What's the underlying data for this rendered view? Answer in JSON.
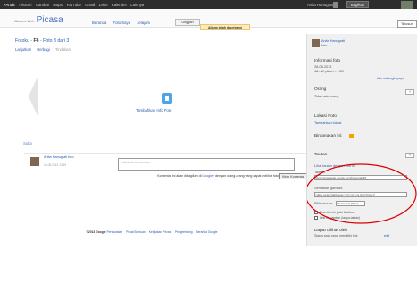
{
  "topbar": {
    "nav": [
      "+Anda",
      "Telusuri",
      "Gambar",
      "Maps",
      "YouTube",
      "Gmail",
      "Drive",
      "Kalender",
      "Lainnya"
    ],
    "user": "Anita Hanugrati",
    "share": "Bagikan"
  },
  "header": {
    "logo_prefix": "Albums Web",
    "logo": "Picasa",
    "tabs": [
      "Beranda",
      "Foto Saya",
      "Jelajahi"
    ],
    "upload": "Unggah",
    "search": "Telusur"
  },
  "notice": "Album telah diperbarui",
  "main": {
    "crumb_prefix": "Fotoku -",
    "crumb_bold": "F6",
    "crumb_suffix": "- Foto 3 dari 3",
    "toolbar": [
      "Lanjutkan",
      "Berbagi",
      "Tindakan"
    ],
    "add_info": "Tambahkan Info Foto",
    "share_line": "Suka",
    "commenter_name": "Anita Hanugrati foto",
    "comment_time": "28-08-2013 13:19",
    "comment_placeholder": "Lakukan komentar",
    "comment_note_1": "Komentar ini akan dibagikan di",
    "comment_note_link": "Google+",
    "comment_note_2": "dengan orang-orang yang dapat melihat foto",
    "post_button": "Kirim Komentar"
  },
  "sidebar": {
    "name": "Anita Hanugrati",
    "name_sub": "foto",
    "info_title": "Informasi foto",
    "info_date": "28-08-2013",
    "info_size": "48×48 piksel – 1KB",
    "info_more": "Info selengkapnya",
    "people_title": "Orang",
    "people_text": "Tidak ada orang",
    "add_btn": "+",
    "location_title": "Lokasi Foto",
    "location_link": "Tambahkan lokasi",
    "rating_title": "Bintangkan ini:",
    "link_title": "Tautan",
    "link_label": "Lihat tautan dengan foto ini",
    "link_field_label": "Tautan:",
    "link_field_value": "https://picasaweb.google.com/hanugrati/F6",
    "embed_label": "Sematkan gambar:",
    "embed_value": "<table style='width:auto;'><tr><td><a href='https://'",
    "size_label": "Pilih ukuran:",
    "size_value": "Ukuran asli (48px)",
    "chk1": "Disertai info judul & album",
    "chk2": "Link ke gambar (tanpa tautan)",
    "shared_title": "Dapat dilihat oleh",
    "shared_text": "Siapa saja yang memiliki link",
    "edit": "edit"
  },
  "footer": {
    "year": "©2013 Google",
    "links": [
      "Persyaratan",
      "Pusat Bantuan",
      "Kebijakan Privasi",
      "Pengembang",
      "Beranda Google"
    ]
  }
}
